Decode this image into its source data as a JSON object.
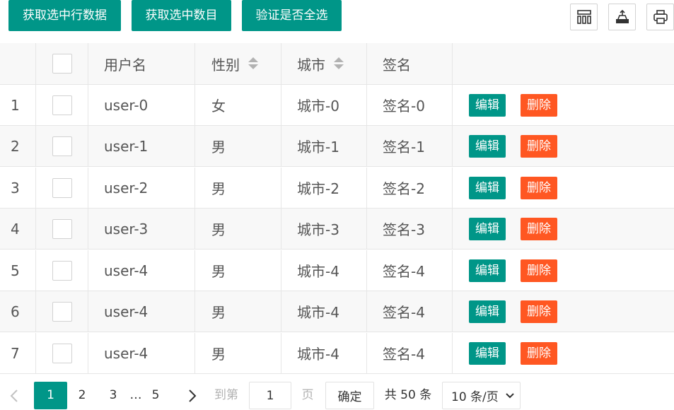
{
  "toolbar": {
    "buttons": [
      "获取选中行数据",
      "获取选中数目",
      "验证是否全选"
    ],
    "icons": [
      "columns-icon",
      "export-icon",
      "print-icon"
    ]
  },
  "table": {
    "headers": {
      "username": "用户名",
      "gender": "性别",
      "city": "城市",
      "sign": "签名"
    },
    "rows": [
      {
        "no": "1",
        "username": "user-0",
        "gender": "女",
        "city": "城市-0",
        "sign": "签名-0"
      },
      {
        "no": "2",
        "username": "user-1",
        "gender": "男",
        "city": "城市-1",
        "sign": "签名-1"
      },
      {
        "no": "3",
        "username": "user-2",
        "gender": "男",
        "city": "城市-2",
        "sign": "签名-2"
      },
      {
        "no": "4",
        "username": "user-3",
        "gender": "男",
        "city": "城市-3",
        "sign": "签名-3"
      },
      {
        "no": "5",
        "username": "user-4",
        "gender": "男",
        "city": "城市-4",
        "sign": "签名-4"
      },
      {
        "no": "6",
        "username": "user-4",
        "gender": "男",
        "city": "城市-4",
        "sign": "签名-4"
      },
      {
        "no": "7",
        "username": "user-4",
        "gender": "男",
        "city": "城市-4",
        "sign": "签名-4"
      }
    ],
    "actions": {
      "edit": "编辑",
      "delete": "删除"
    }
  },
  "pager": {
    "pages": [
      "1",
      "2",
      "3",
      "…",
      "5"
    ],
    "current": "1",
    "goto_label": "到第",
    "goto_value": "1",
    "page_label": "页",
    "confirm": "确定",
    "total": "共 50 条",
    "page_size": "10 条/页"
  },
  "colors": {
    "primary": "#009688",
    "danger": "#ff5722"
  }
}
